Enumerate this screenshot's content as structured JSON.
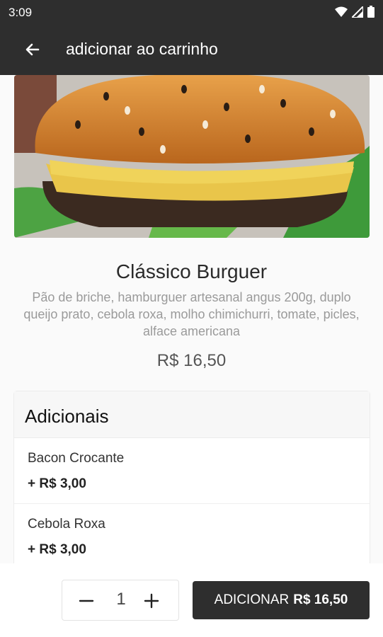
{
  "status_bar": {
    "time": "3:09",
    "icons": [
      "wifi-icon",
      "signal-icon",
      "battery-icon"
    ]
  },
  "app_bar": {
    "back_icon": "arrow-left-icon",
    "title": "adicionar ao carrinho"
  },
  "product": {
    "image": "burger-photo",
    "name": "Clássico Burguer",
    "description": "Pão de briche, hamburguer artesanal angus 200g, duplo queijo prato, cebola roxa, molho chimichurri, tomate, picles, alface americana",
    "price": "R$ 16,50"
  },
  "addons": {
    "title": "Adicionais",
    "items": [
      {
        "name": "Bacon Crocante",
        "price": "+ R$ 3,00"
      },
      {
        "name": "Cebola Roxa",
        "price": "+ R$ 3,00"
      }
    ]
  },
  "cart": {
    "quantity": "1",
    "minus_icon": "minus-icon",
    "plus_icon": "plus-icon",
    "add_label": "ADICIONAR",
    "add_amount": "R$ 16,50"
  },
  "colors": {
    "bar": "#2e2e2e",
    "background": "#fafafa",
    "muted_text": "#9a9a9a"
  }
}
